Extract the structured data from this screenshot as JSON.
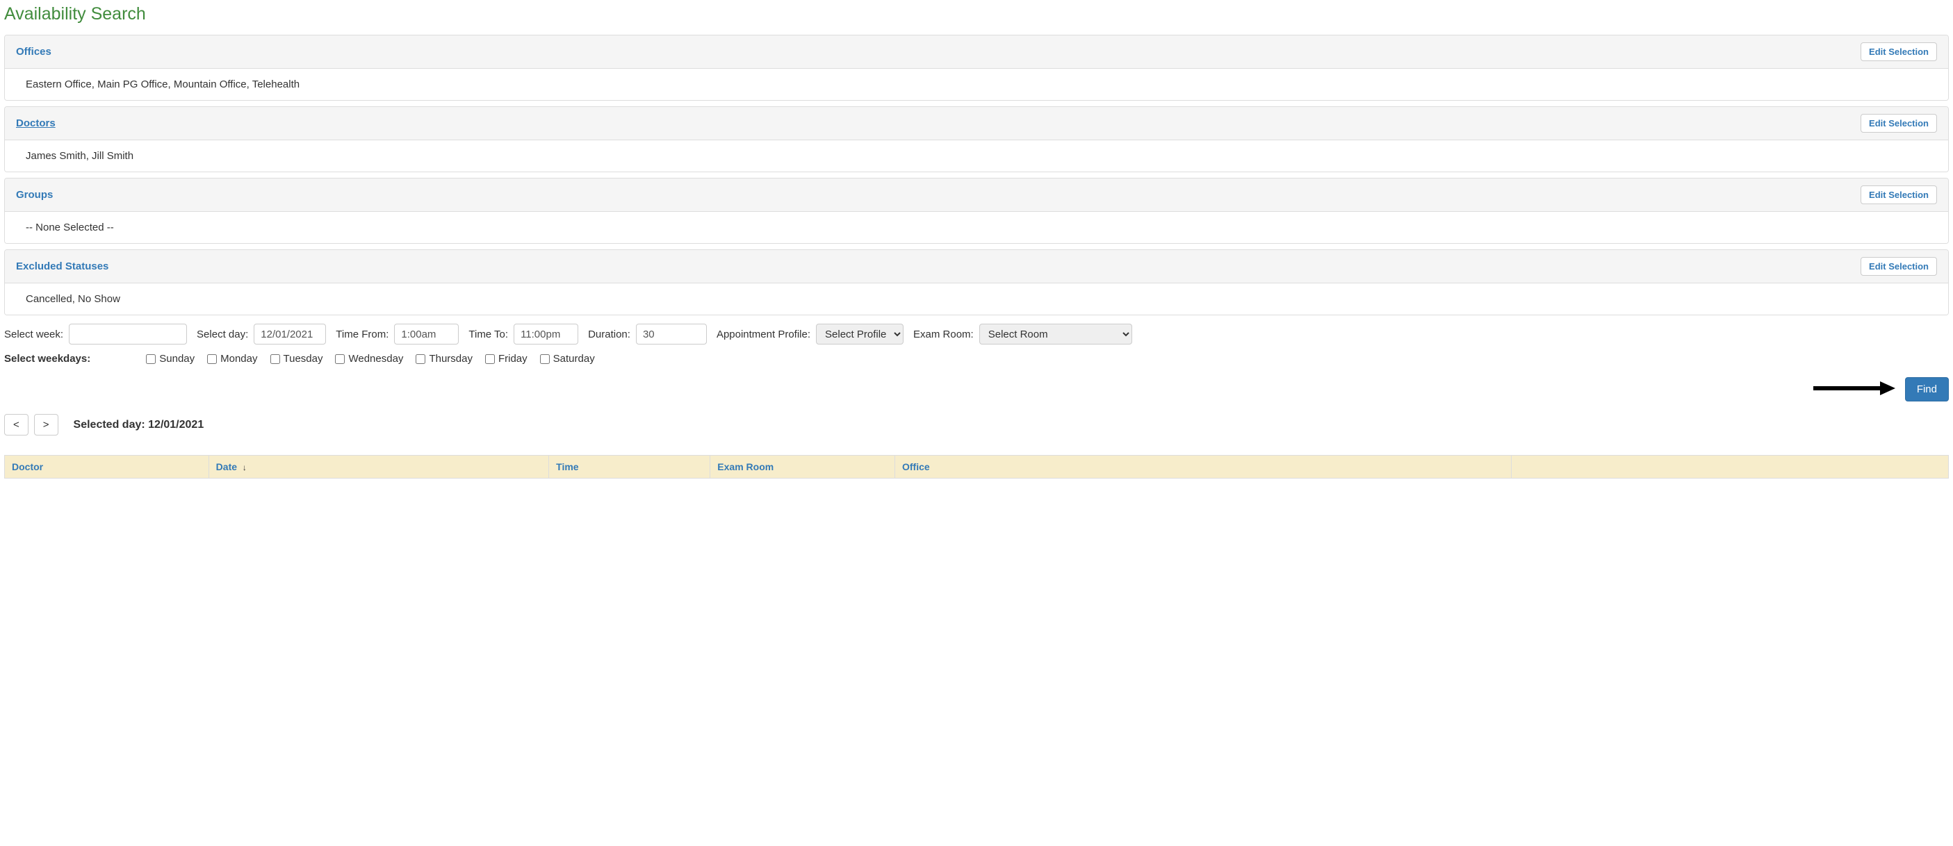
{
  "page": {
    "title": "Availability Search"
  },
  "panels": {
    "offices": {
      "title": "Offices",
      "edit_label": "Edit Selection",
      "body": "Eastern Office, Main PG Office, Mountain Office, Telehealth"
    },
    "doctors": {
      "title": "Doctors",
      "edit_label": "Edit Selection",
      "body": "James Smith,  Jill Smith"
    },
    "groups": {
      "title": "Groups",
      "edit_label": "Edit Selection",
      "body": "-- None Selected --"
    },
    "excluded": {
      "title": "Excluded Statuses",
      "edit_label": "Edit Selection",
      "body": "Cancelled, No Show"
    }
  },
  "filters": {
    "select_week_label": "Select week:",
    "select_week_value": "",
    "select_day_label": "Select day:",
    "select_day_value": "12/01/2021",
    "time_from_label": "Time From:",
    "time_from_value": "1:00am",
    "time_to_label": "Time To:",
    "time_to_value": "11:00pm",
    "duration_label": "Duration:",
    "duration_value": "30",
    "appt_profile_label": "Appointment Profile:",
    "appt_profile_option": "Select Profile",
    "exam_room_label": "Exam Room:",
    "exam_room_option": "Select Room"
  },
  "weekdays": {
    "label": "Select weekdays:",
    "days": {
      "sunday": "Sunday",
      "monday": "Monday",
      "tuesday": "Tuesday",
      "wednesday": "Wednesday",
      "thursday": "Thursday",
      "friday": "Friday",
      "saturday": "Saturday"
    }
  },
  "buttons": {
    "find": "Find",
    "prev": "<",
    "next": ">"
  },
  "selected_day": {
    "label": "Selected day: ",
    "value": "12/01/2021"
  },
  "table": {
    "headers": {
      "doctor": "Doctor",
      "date": "Date",
      "time": "Time",
      "exam_room": "Exam Room",
      "office": "Office",
      "action": ""
    }
  }
}
